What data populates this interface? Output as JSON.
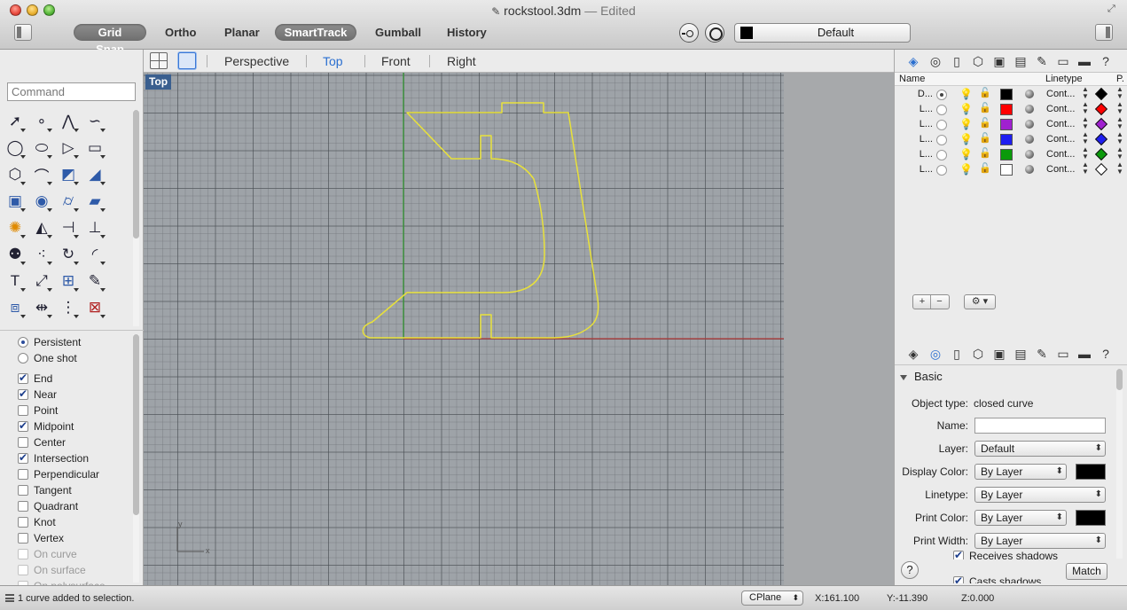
{
  "window": {
    "title": "rockstool.3dm",
    "edited_label": "— Edited"
  },
  "toolbar": {
    "modes": [
      {
        "label": "Grid Snap",
        "active": true
      },
      {
        "label": "Ortho",
        "active": false
      },
      {
        "label": "Planar",
        "active": false
      },
      {
        "label": "SmartTrack",
        "active": true
      },
      {
        "label": "Gumball",
        "active": false
      },
      {
        "label": "History",
        "active": false
      }
    ],
    "layer_dropdown": {
      "label": "Default",
      "swatch_color": "#000000"
    }
  },
  "viewbar": {
    "tabs": [
      "Perspective",
      "Top",
      "Front",
      "Right"
    ],
    "active_tab": "Top"
  },
  "viewport": {
    "label": "Top",
    "curve_color": "#e8e13a",
    "x_axis_color": "#b03a3a",
    "y_axis_color": "#3a9a3a",
    "axis_x_label": "x",
    "axis_y_label": "y"
  },
  "command": {
    "placeholder": "Command"
  },
  "tools": [
    "select-arrow-icon",
    "point-icon",
    "polyline-icon",
    "curve-icon",
    "circle-icon",
    "ellipse-icon",
    "polygon-icon",
    "rectangle-icon",
    "hexagon-icon",
    "fillet-curve-icon",
    "surface-from-points-icon",
    "loft-icon",
    "box-icon",
    "sphere-icon",
    "cylinder-icon",
    "plane-surface-icon",
    "explode-icon",
    "boolean-icon",
    "split-icon",
    "trim-icon",
    "group-icon",
    "array-points-icon",
    "rotate-icon",
    "arc-icon",
    "text-icon",
    "move-icon",
    "grid-array-icon",
    "edit-icon",
    "render-box-icon",
    "dimension-icon",
    "array-icon",
    "lock-icon"
  ],
  "osnaps": {
    "modes": [
      {
        "label": "Persistent",
        "checked": true
      },
      {
        "label": "One shot",
        "checked": false
      }
    ],
    "snaps": [
      {
        "label": "End",
        "checked": true,
        "enabled": true
      },
      {
        "label": "Near",
        "checked": true,
        "enabled": true
      },
      {
        "label": "Point",
        "checked": false,
        "enabled": true
      },
      {
        "label": "Midpoint",
        "checked": true,
        "enabled": true
      },
      {
        "label": "Center",
        "checked": false,
        "enabled": true
      },
      {
        "label": "Intersection",
        "checked": true,
        "enabled": true
      },
      {
        "label": "Perpendicular",
        "checked": false,
        "enabled": true
      },
      {
        "label": "Tangent",
        "checked": false,
        "enabled": true
      },
      {
        "label": "Quadrant",
        "checked": false,
        "enabled": true
      },
      {
        "label": "Knot",
        "checked": false,
        "enabled": true
      },
      {
        "label": "Vertex",
        "checked": false,
        "enabled": true
      },
      {
        "label": "On curve",
        "checked": false,
        "enabled": false
      },
      {
        "label": "On surface",
        "checked": false,
        "enabled": false
      },
      {
        "label": "On polysurface",
        "checked": false,
        "enabled": false
      }
    ]
  },
  "layers_panel": {
    "columns": {
      "name": "Name",
      "linetype": "Linetype",
      "print": "P."
    },
    "rows": [
      {
        "name": "D...",
        "current": true,
        "color": "#000000",
        "linetype": "Cont...",
        "print_color": "#000000"
      },
      {
        "name": "L...",
        "current": false,
        "color": "#ff0000",
        "linetype": "Cont...",
        "print_color": "#ff0000"
      },
      {
        "name": "L...",
        "current": false,
        "color": "#a020d0",
        "linetype": "Cont...",
        "print_color": "#a020d0"
      },
      {
        "name": "L...",
        "current": false,
        "color": "#1e1ef0",
        "linetype": "Cont...",
        "print_color": "#1e1ef0"
      },
      {
        "name": "L...",
        "current": false,
        "color": "#0a9a0a",
        "linetype": "Cont...",
        "print_color": "#0a9a0a"
      },
      {
        "name": "L...",
        "current": false,
        "color": "#ffffff",
        "linetype": "Cont...",
        "print_color": "#ffffff"
      }
    ],
    "add_label": "+",
    "remove_label": "−",
    "gear_label": "⚙ ▾"
  },
  "properties": {
    "section": "Basic",
    "object_type": "closed curve",
    "labels": {
      "object_type": "Object type:",
      "name": "Name:",
      "layer": "Layer:",
      "display_color": "Display Color:",
      "linetype": "Linetype:",
      "print_color": "Print Color:",
      "print_width": "Print Width:"
    },
    "values": {
      "layer": "Default",
      "display_color": "By Layer",
      "linetype": "By Layer",
      "print_color": "By Layer",
      "print_width": "By Layer"
    },
    "receives_shadows": {
      "label": "Receives shadows",
      "checked": true
    },
    "casts_shadows": {
      "label": "Casts shadows",
      "checked": true
    },
    "help_label": "?",
    "match_label": "Match"
  },
  "statusbar": {
    "message": "1 curve added to selection.",
    "cplane": "CPlane",
    "x": "X:161.100",
    "y": "Y:-11.390",
    "z": "Z:0.000"
  }
}
